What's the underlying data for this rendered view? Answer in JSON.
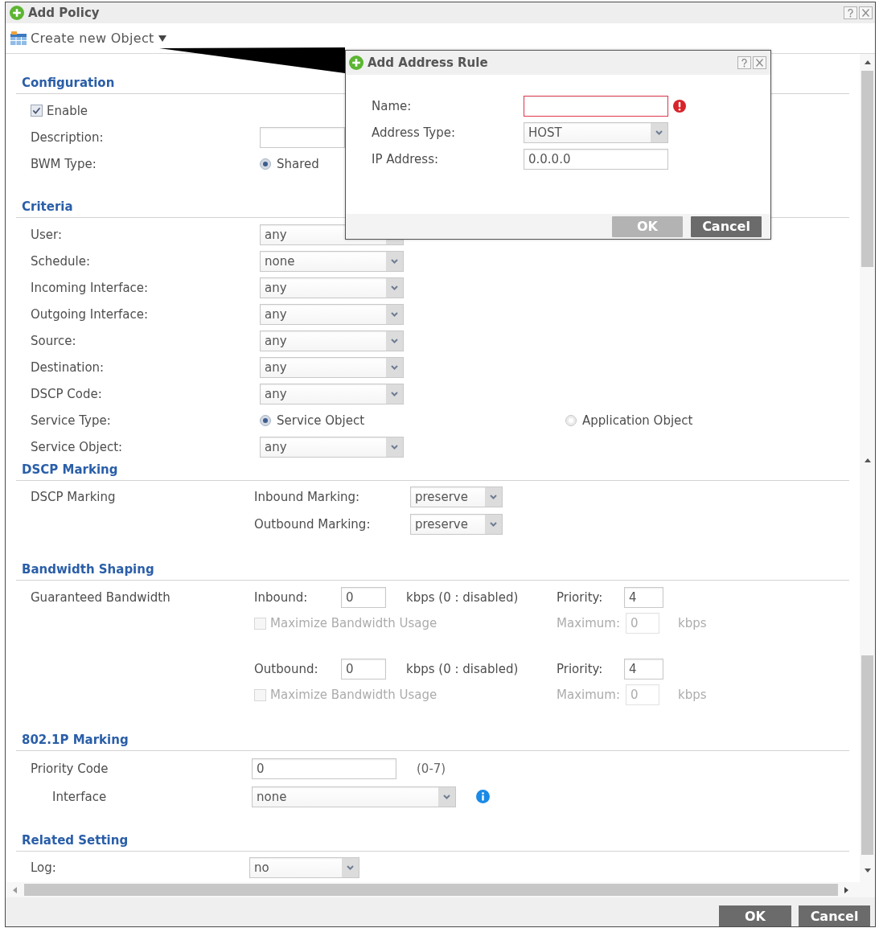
{
  "window": {
    "title": "Add Policy"
  },
  "toolbar": {
    "menu": "Create new Object"
  },
  "sections": [
    {
      "title": "Configuration",
      "rows": [
        {
          "kind": "checkbox",
          "label": "Enable",
          "checked": true
        },
        {
          "kind": "input",
          "label": "Description:"
        },
        {
          "kind": "radio",
          "label": "BWM Type:",
          "options": [
            {
              "label": "Shared",
              "selected": true
            }
          ]
        }
      ]
    },
    {
      "title": "Criteria",
      "rows": [
        {
          "kind": "select",
          "label": "User:",
          "value": "any"
        },
        {
          "kind": "select",
          "label": "Schedule:",
          "value": "none"
        },
        {
          "kind": "select",
          "label": "Incoming Interface:",
          "value": "any"
        },
        {
          "kind": "select",
          "label": "Outgoing Interface:",
          "value": "any"
        },
        {
          "kind": "select",
          "label": "Source:",
          "value": "any"
        },
        {
          "kind": "select",
          "label": "Destination:",
          "value": "any"
        },
        {
          "kind": "select",
          "label": "DSCP Code:",
          "value": "any"
        },
        {
          "kind": "radio",
          "label": "Service Type:",
          "options": [
            {
              "label": "Service Object",
              "selected": true
            },
            {
              "label": "Application Object",
              "selected": false
            }
          ]
        },
        {
          "kind": "select",
          "label": "Service Object:",
          "value": "any"
        }
      ]
    },
    {
      "title": "DSCP Marking",
      "rows": [
        {
          "kind": "marking",
          "label": "DSCP Marking",
          "fields": [
            {
              "label": "Inbound Marking:",
              "value": "preserve"
            },
            {
              "label": "Outbound Marking:",
              "value": "preserve"
            }
          ]
        }
      ]
    },
    {
      "title": "Bandwidth Shaping",
      "rows": [
        {
          "kind": "bandwidth",
          "label": "Guaranteed Bandwidth",
          "directions": [
            {
              "label": "Inbound:",
              "value": "0",
              "unit": "kbps (0 : disabled)",
              "priority_label": "Priority:",
              "priority": "4",
              "maximize": {
                "label": "Maximize Bandwidth Usage",
                "checked": false,
                "disabled": true,
                "maximum_label": "Maximum:",
                "maximum": "0",
                "unit": "kbps"
              }
            },
            {
              "label": "Outbound:",
              "value": "0",
              "unit": "kbps (0 : disabled)",
              "priority_label": "Priority:",
              "priority": "4",
              "maximize": {
                "label": "Maximize Bandwidth Usage",
                "checked": false,
                "disabled": true,
                "maximum_label": "Maximum:",
                "maximum": "0",
                "unit": "kbps"
              }
            }
          ]
        }
      ]
    },
    {
      "title": "802.1P Marking",
      "rows": [
        {
          "kind": "input",
          "label": "Priority Code",
          "value": "0",
          "hint": "(0-7)"
        },
        {
          "kind": "select",
          "label": "Interface",
          "value": "none",
          "info": true
        }
      ]
    },
    {
      "title": "Related Setting",
      "rows": [
        {
          "kind": "select",
          "label": "Log:",
          "value": "no"
        }
      ]
    }
  ],
  "footer": {
    "buttons": [
      {
        "label": "OK",
        "disabled": false
      },
      {
        "label": "Cancel",
        "disabled": false
      }
    ]
  },
  "dialog": {
    "title": "Add Address Rule",
    "fields": [
      {
        "kind": "input",
        "label": "Name:",
        "invalid": true
      },
      {
        "kind": "select",
        "label": "Address Type:",
        "value": "HOST"
      },
      {
        "kind": "input",
        "label": "IP Address:",
        "value": "0.0.0.0",
        "invalid": false
      }
    ],
    "buttons": [
      {
        "label": "OK",
        "disabled": true
      },
      {
        "label": "Cancel",
        "disabled": false
      }
    ]
  }
}
